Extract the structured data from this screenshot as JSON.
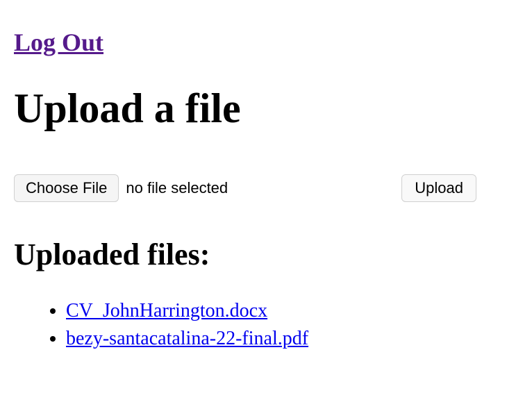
{
  "header": {
    "logout_label": "Log Out"
  },
  "main": {
    "title": "Upload a file",
    "choose_file_label": "Choose File",
    "file_status": "no file selected",
    "upload_button_label": "Upload"
  },
  "uploaded": {
    "heading": "Uploaded files:",
    "files": [
      "CV_JohnHarrington.docx",
      "bezy-santacatalina-22-final.pdf"
    ]
  }
}
